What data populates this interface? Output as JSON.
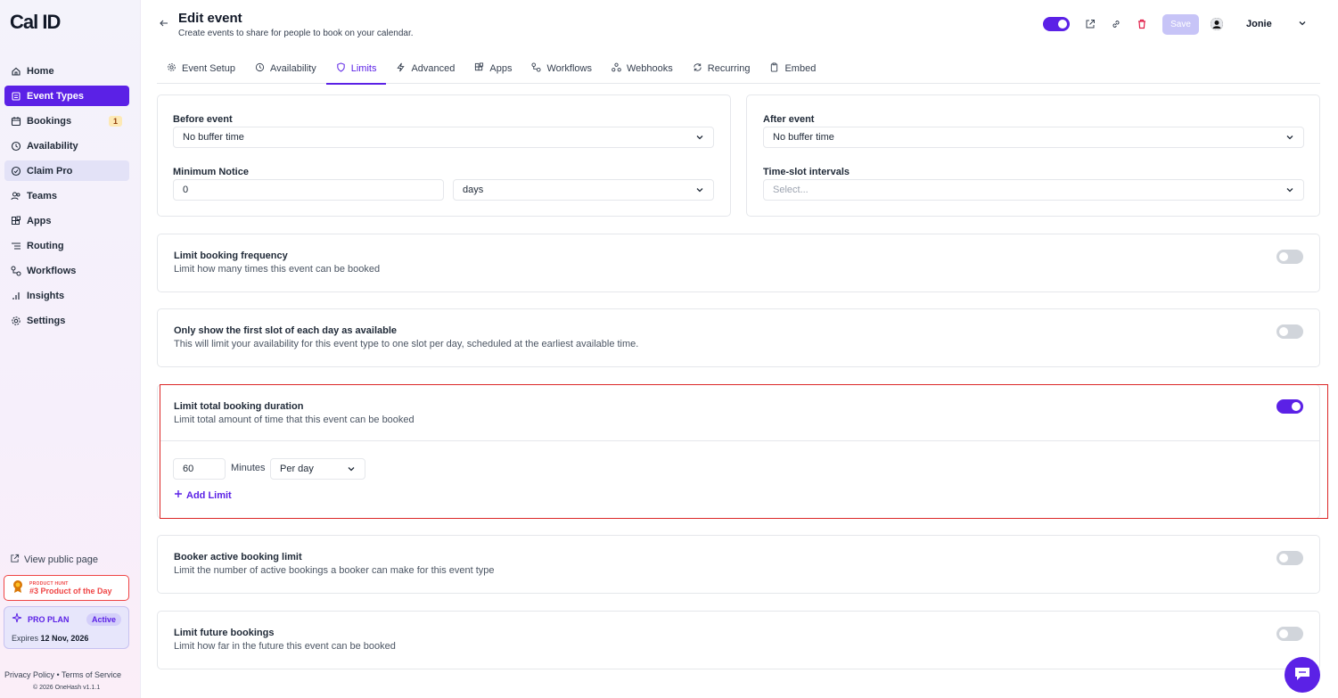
{
  "app": {
    "logo": "Cal ID"
  },
  "sidebar": {
    "items": [
      {
        "label": "Home",
        "icon": "home-icon"
      },
      {
        "label": "Event Types",
        "icon": "event-types-icon",
        "active": true
      },
      {
        "label": "Bookings",
        "icon": "calendar-icon",
        "count": "1"
      },
      {
        "label": "Availability",
        "icon": "clock-icon"
      },
      {
        "label": "Claim Pro",
        "icon": "badge-icon"
      },
      {
        "label": "Teams",
        "icon": "users-icon"
      },
      {
        "label": "Apps",
        "icon": "grid-icon"
      },
      {
        "label": "Routing",
        "icon": "routing-icon"
      },
      {
        "label": "Workflows",
        "icon": "workflow-icon"
      },
      {
        "label": "Insights",
        "icon": "chart-icon"
      },
      {
        "label": "Settings",
        "icon": "gear-icon"
      }
    ],
    "view_public": "View public page",
    "product_hunt_small": "PRODUCT HUNT",
    "product_hunt_main": "#3 Product of the Day",
    "plan_label": "PRO PLAN",
    "plan_status": "Active",
    "expires_prefix": "Expires",
    "expires_date": "12 Nov, 2026",
    "privacy": "Privacy Policy",
    "separator": "•",
    "terms": "Terms of Service",
    "copyright": "© 2026 OneHash v1.1.1"
  },
  "header": {
    "title": "Edit event",
    "subtitle": "Create events to share for people to book on your calendar.",
    "save_label": "Save",
    "user_name": "Jonie"
  },
  "tabs": [
    {
      "label": "Event Setup",
      "icon": "gear-icon"
    },
    {
      "label": "Availability",
      "icon": "clock-icon"
    },
    {
      "label": "Limits",
      "icon": "shield-icon",
      "active": true
    },
    {
      "label": "Advanced",
      "icon": "bolt-icon"
    },
    {
      "label": "Apps",
      "icon": "grid-icon"
    },
    {
      "label": "Workflows",
      "icon": "workflow-icon"
    },
    {
      "label": "Webhooks",
      "icon": "webhook-icon"
    },
    {
      "label": "Recurring",
      "icon": "repeat-icon"
    },
    {
      "label": "Embed",
      "icon": "clipboard-icon"
    }
  ],
  "buffer": {
    "before_label": "Before event",
    "before_value": "No buffer time",
    "after_label": "After event",
    "after_value": "No buffer time",
    "notice_label": "Minimum Notice",
    "notice_value": "0",
    "notice_unit": "days",
    "interval_label": "Time-slot intervals",
    "interval_placeholder": "Select..."
  },
  "limits": {
    "frequency_title": "Limit booking frequency",
    "frequency_desc": "Limit how many times this event can be booked",
    "first_slot_title": "Only show the first slot of each day as available",
    "first_slot_desc": "This will limit your availability for this event type to one slot per day, scheduled at the earliest available time.",
    "duration_title": "Limit total booking duration",
    "duration_desc": "Limit total amount of time that this event can be booked",
    "duration_value": "60",
    "duration_unit": "Minutes",
    "duration_period": "Per day",
    "add_limit": "Add Limit",
    "booker_title": "Booker active booking limit",
    "booker_desc": "Limit the number of active bookings a booker can make for this event type",
    "future_title": "Limit future bookings",
    "future_desc": "Limit how far in the future this event can be booked"
  },
  "colors": {
    "accent": "#5b21e6",
    "highlight": "#dc2626",
    "danger": "#e11d48"
  }
}
